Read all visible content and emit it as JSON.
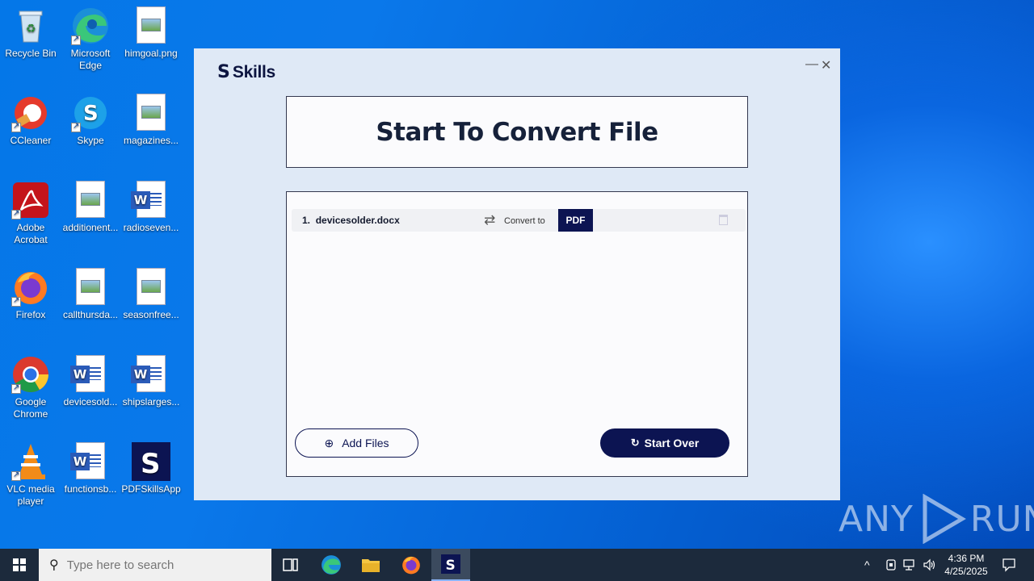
{
  "desktop": {
    "icons": [
      {
        "label": "Recycle Bin"
      },
      {
        "label": "Microsoft Edge"
      },
      {
        "label": "himgoal.png"
      },
      {
        "label": "CCleaner"
      },
      {
        "label": "Skype"
      },
      {
        "label": "magazines..."
      },
      {
        "label": "Adobe Acrobat"
      },
      {
        "label": "additionent..."
      },
      {
        "label": "radioseven..."
      },
      {
        "label": "Firefox"
      },
      {
        "label": "callthursda..."
      },
      {
        "label": "seasonfree..."
      },
      {
        "label": "Google Chrome"
      },
      {
        "label": "devicesold..."
      },
      {
        "label": "shipslarges..."
      },
      {
        "label": "VLC media player"
      },
      {
        "label": "functionsb..."
      },
      {
        "label": "PDFSkillsApp"
      }
    ]
  },
  "app": {
    "brand_name": "Skills",
    "brand_mark": "S",
    "minimize_glyph": "—",
    "close_glyph": "✕",
    "heading": "Start To Convert File",
    "files": [
      {
        "index": "1.",
        "name": "devicesolder.docx",
        "convert_label": "Convert to",
        "format": "PDF"
      }
    ],
    "add_files_label": "Add Files",
    "start_over_label": "Start Over",
    "accent_color": "#0c1452"
  },
  "watermark": {
    "text_left": "ANY",
    "text_right": "RUN"
  },
  "taskbar": {
    "search_placeholder": "Type here to search",
    "time": "4:36 PM",
    "date": "4/25/2025"
  }
}
